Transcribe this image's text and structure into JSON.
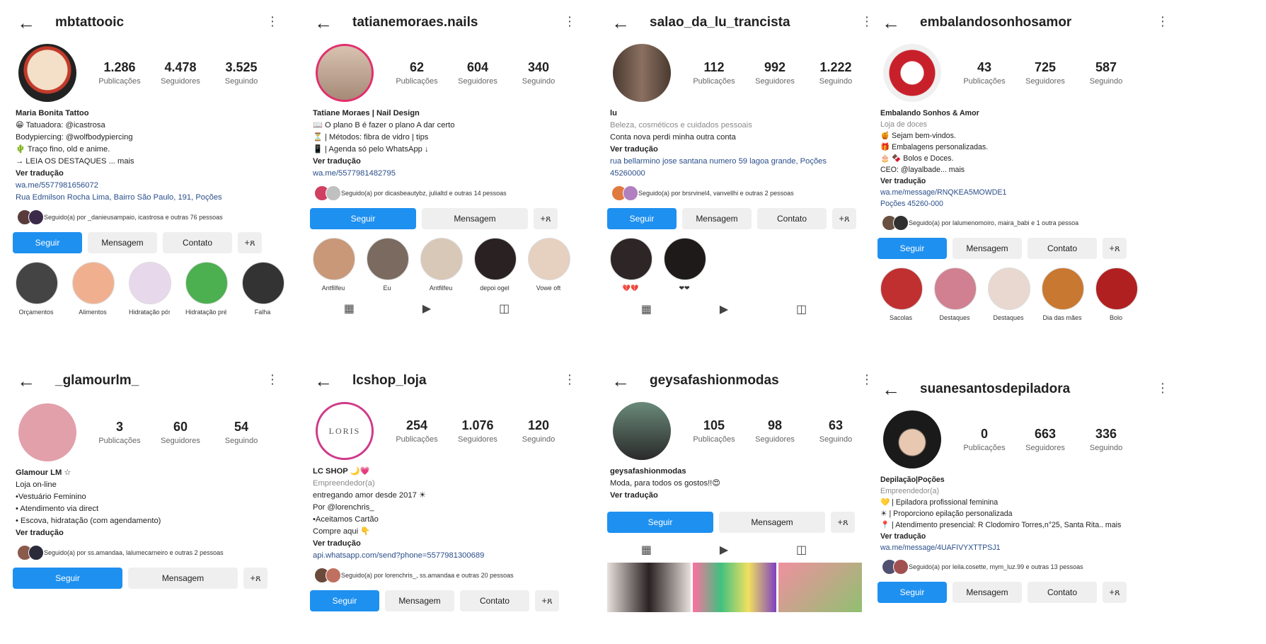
{
  "profiles": [
    {
      "username": "mbtattooic",
      "stats": [
        {
          "value": "1.286",
          "label": "Publicações"
        },
        {
          "value": "4.478",
          "label": "Seguidores"
        },
        {
          "value": "3.525",
          "label": "Seguindo"
        }
      ],
      "bio": {
        "name": "Maria Bonita Tattoo",
        "line1": "😁 Tatuadora: @icastrosa",
        "line2": "Bodypiercing: @wolfbodypiercing",
        "line3": "🌵 Traço fino, old e anime.",
        "line4": "→ LEIA OS DESTAQUES ... mais",
        "translate": "Ver tradução",
        "link1": "wa.me/5577981656072",
        "link2": "Rua Edmilson Rocha Lima, Bairro São Paulo, 191, Poções"
      },
      "followed_by": "Seguido(a) por _danieusampaio, icastrosa e outras 76 pessoas",
      "buttons": {
        "follow": "Seguir",
        "message": "Mensagem",
        "contact": "Contato",
        "add": "+ጸ"
      },
      "highlights": [
        "Orçamentos",
        "Alimentos",
        "Hidratação pós",
        "Hidratação pré",
        "Falha"
      ]
    },
    {
      "username": "tatianemoraes.nails",
      "stats": [
        {
          "value": "62",
          "label": "Publicações"
        },
        {
          "value": "604",
          "label": "Seguidores"
        },
        {
          "value": "340",
          "label": "Seguindo"
        }
      ],
      "bio": {
        "name": "Tatiane Moraes | Nail Design",
        "line1": "📖 O plano B é fazer o plano A dar certo",
        "line2": "⏳ | Métodos: fibra de vidro | tips",
        "line3": "📱 | Agenda só pelo WhatsApp ↓",
        "translate": "Ver tradução",
        "link1": "wa.me/5577981482795"
      },
      "followed_by": "Seguido(a) por dicasbeautybz, julialtd e outras 14 pessoas",
      "buttons": {
        "follow": "Seguir",
        "message": "Mensagem",
        "add": "+ጸ"
      },
      "highlights": [
        "Antfilfeu",
        "Eu",
        "Antfilfeu",
        "depoi ogel",
        "Vowe oft"
      ]
    },
    {
      "username": "salao_da_lu_trancista",
      "stats": [
        {
          "value": "112",
          "label": "Publicações"
        },
        {
          "value": "992",
          "label": "Seguidores"
        },
        {
          "value": "1.222",
          "label": "Seguindo"
        }
      ],
      "bio": {
        "name": "lu",
        "line1": "Beleza, cosméticos e cuidados pessoais",
        "line2": "Conta nova perdi minha outra conta",
        "translate": "Ver tradução",
        "link1": "rua bellarmino jose santana numero 59 lagoa grande, Poções",
        "link2": "45260000"
      },
      "followed_by": "Seguido(a) por brsrvinel4, vanvellhi e outras 2 pessoas",
      "buttons": {
        "follow": "Seguir",
        "message": "Mensagem",
        "contact": "Contato",
        "add": "+ጸ"
      },
      "highlights": [
        "💔💔",
        "❤❤"
      ]
    },
    {
      "username": "embalandosonhosamor",
      "stats": [
        {
          "value": "43",
          "label": "Publicações"
        },
        {
          "value": "725",
          "label": "Seguidores"
        },
        {
          "value": "587",
          "label": "Seguindo"
        }
      ],
      "bio": {
        "name": "Embalando Sonhos & Amor",
        "line1": "Loja de doces",
        "line2": "🍯 Sejam bem-vindos.",
        "line3": "🎁 Embalagens personalizadas.",
        "line4": "🎂 🍫 Bolos e Doces.",
        "line5": "CEO: @layalbade... mais",
        "translate": "Ver tradução",
        "link1": "wa.me/message/RNQKEA5MOWDE1",
        "link2": "Poções 45260-000"
      },
      "followed_by": "Seguido(a) por lalumenomoiro, maira_babi e 1 outra pessoa",
      "buttons": {
        "follow": "Seguir",
        "message": "Mensagem",
        "contact": "Contato",
        "add": "+ጸ"
      },
      "highlights": [
        "Sacolas",
        "Destaques",
        "Destaques",
        "Dia das mães",
        "Bolo"
      ]
    },
    {
      "username": "_glamourlm_",
      "stats": [
        {
          "value": "3",
          "label": "Publicações"
        },
        {
          "value": "60",
          "label": "Seguidores"
        },
        {
          "value": "54",
          "label": "Seguindo"
        }
      ],
      "bio": {
        "name": "Glamour LM ☆",
        "line1": "Loja on-line",
        "line2": "•Vestuário Feminino",
        "line3": "• Atendimento via direct",
        "line4": "• Escova, hidratação (com agendamento)",
        "translate": "Ver tradução"
      },
      "followed_by": "Seguido(a) por ss.amandaa, lalumecarneiro e outras 2 pessoas",
      "buttons": {
        "follow": "Seguir",
        "message": "Mensagem",
        "add": "+ጸ"
      }
    },
    {
      "username": "lcshop_loja",
      "stats": [
        {
          "value": "254",
          "label": "Publicações"
        },
        {
          "value": "1.076",
          "label": "Seguidores"
        },
        {
          "value": "120",
          "label": "Seguindo"
        }
      ],
      "avatar_text": "LORIS",
      "bio": {
        "name": "LC SHOP 🌙💗",
        "line1": "Empreendedor(a)",
        "line2": "entregando amor desde 2017 ☀",
        "line3": "Por @lorenchris_",
        "line4": "•Aceitamos Cartão",
        "line5": "Compre aqui 👇",
        "translate": "Ver tradução",
        "link1": "api.whatsapp.com/send?phone=5577981300689"
      },
      "followed_by": "Seguido(a) por lorenchris_, ss.amandaa e outras 20 pessoas",
      "buttons": {
        "follow": "Seguir",
        "message": "Mensagem",
        "contact": "Contato",
        "add": "+ጸ"
      }
    },
    {
      "username": "geysafashionmodas",
      "stats": [
        {
          "value": "105",
          "label": "Publicações"
        },
        {
          "value": "98",
          "label": "Seguidores"
        },
        {
          "value": "63",
          "label": "Seguindo"
        }
      ],
      "bio": {
        "name": "geysafashionmodas",
        "line1": "Moda, para todos os gostos!!😍",
        "translate": "Ver tradução"
      },
      "buttons": {
        "follow": "Seguir",
        "message": "Mensagem",
        "add": "+ጸ"
      }
    },
    {
      "username": "suanesantosdepiladora",
      "stats": [
        {
          "value": "0",
          "label": "Publicações"
        },
        {
          "value": "663",
          "label": "Seguidores"
        },
        {
          "value": "336",
          "label": "Seguindo"
        }
      ],
      "bio": {
        "name": "Depilação|Poções",
        "line1": "Empreendedor(a)",
        "line2": "💛 | Epiladora profissional feminina",
        "line3": "☀ | Proporciono epilação personalizada",
        "line4": "📍 | Atendimento presencial: R Clodomiro Torres,n°25, Santa Rita.. mais",
        "translate": "Ver tradução",
        "link1": "wa.me/message/4UAFIVYXTTPSJ1"
      },
      "followed_by": "Seguido(a) por leila.cosette, mym_luz.99 e outras 13 pessoas",
      "buttons": {
        "follow": "Seguir",
        "message": "Mensagem",
        "contact": "Contato",
        "add": "+ጸ"
      }
    }
  ],
  "icons": {
    "back": "←",
    "kebab": "⋮",
    "grid": "▦",
    "reels": "▶",
    "tagged": "◫"
  },
  "colors": {
    "primary_button": "#1e90f0",
    "secondary_button": "#efefef",
    "link": "#2a4e8a"
  }
}
